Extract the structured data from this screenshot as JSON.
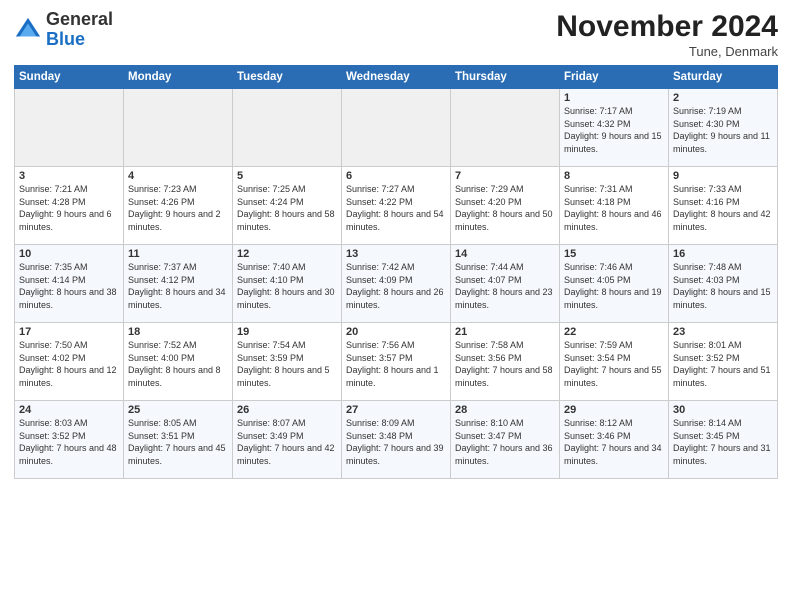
{
  "logo": {
    "general": "General",
    "blue": "Blue"
  },
  "header": {
    "title": "November 2024",
    "location": "Tune, Denmark"
  },
  "days_of_week": [
    "Sunday",
    "Monday",
    "Tuesday",
    "Wednesday",
    "Thursday",
    "Friday",
    "Saturday"
  ],
  "weeks": [
    [
      {
        "day": "",
        "sunrise": "",
        "sunset": "",
        "daylight": "",
        "empty": true
      },
      {
        "day": "",
        "sunrise": "",
        "sunset": "",
        "daylight": "",
        "empty": true
      },
      {
        "day": "",
        "sunrise": "",
        "sunset": "",
        "daylight": "",
        "empty": true
      },
      {
        "day": "",
        "sunrise": "",
        "sunset": "",
        "daylight": "",
        "empty": true
      },
      {
        "day": "",
        "sunrise": "",
        "sunset": "",
        "daylight": "",
        "empty": true
      },
      {
        "day": "1",
        "sunrise": "Sunrise: 7:17 AM",
        "sunset": "Sunset: 4:32 PM",
        "daylight": "Daylight: 9 hours and 15 minutes.",
        "empty": false
      },
      {
        "day": "2",
        "sunrise": "Sunrise: 7:19 AM",
        "sunset": "Sunset: 4:30 PM",
        "daylight": "Daylight: 9 hours and 11 minutes.",
        "empty": false
      }
    ],
    [
      {
        "day": "3",
        "sunrise": "Sunrise: 7:21 AM",
        "sunset": "Sunset: 4:28 PM",
        "daylight": "Daylight: 9 hours and 6 minutes.",
        "empty": false
      },
      {
        "day": "4",
        "sunrise": "Sunrise: 7:23 AM",
        "sunset": "Sunset: 4:26 PM",
        "daylight": "Daylight: 9 hours and 2 minutes.",
        "empty": false
      },
      {
        "day": "5",
        "sunrise": "Sunrise: 7:25 AM",
        "sunset": "Sunset: 4:24 PM",
        "daylight": "Daylight: 8 hours and 58 minutes.",
        "empty": false
      },
      {
        "day": "6",
        "sunrise": "Sunrise: 7:27 AM",
        "sunset": "Sunset: 4:22 PM",
        "daylight": "Daylight: 8 hours and 54 minutes.",
        "empty": false
      },
      {
        "day": "7",
        "sunrise": "Sunrise: 7:29 AM",
        "sunset": "Sunset: 4:20 PM",
        "daylight": "Daylight: 8 hours and 50 minutes.",
        "empty": false
      },
      {
        "day": "8",
        "sunrise": "Sunrise: 7:31 AM",
        "sunset": "Sunset: 4:18 PM",
        "daylight": "Daylight: 8 hours and 46 minutes.",
        "empty": false
      },
      {
        "day": "9",
        "sunrise": "Sunrise: 7:33 AM",
        "sunset": "Sunset: 4:16 PM",
        "daylight": "Daylight: 8 hours and 42 minutes.",
        "empty": false
      }
    ],
    [
      {
        "day": "10",
        "sunrise": "Sunrise: 7:35 AM",
        "sunset": "Sunset: 4:14 PM",
        "daylight": "Daylight: 8 hours and 38 minutes.",
        "empty": false
      },
      {
        "day": "11",
        "sunrise": "Sunrise: 7:37 AM",
        "sunset": "Sunset: 4:12 PM",
        "daylight": "Daylight: 8 hours and 34 minutes.",
        "empty": false
      },
      {
        "day": "12",
        "sunrise": "Sunrise: 7:40 AM",
        "sunset": "Sunset: 4:10 PM",
        "daylight": "Daylight: 8 hours and 30 minutes.",
        "empty": false
      },
      {
        "day": "13",
        "sunrise": "Sunrise: 7:42 AM",
        "sunset": "Sunset: 4:09 PM",
        "daylight": "Daylight: 8 hours and 26 minutes.",
        "empty": false
      },
      {
        "day": "14",
        "sunrise": "Sunrise: 7:44 AM",
        "sunset": "Sunset: 4:07 PM",
        "daylight": "Daylight: 8 hours and 23 minutes.",
        "empty": false
      },
      {
        "day": "15",
        "sunrise": "Sunrise: 7:46 AM",
        "sunset": "Sunset: 4:05 PM",
        "daylight": "Daylight: 8 hours and 19 minutes.",
        "empty": false
      },
      {
        "day": "16",
        "sunrise": "Sunrise: 7:48 AM",
        "sunset": "Sunset: 4:03 PM",
        "daylight": "Daylight: 8 hours and 15 minutes.",
        "empty": false
      }
    ],
    [
      {
        "day": "17",
        "sunrise": "Sunrise: 7:50 AM",
        "sunset": "Sunset: 4:02 PM",
        "daylight": "Daylight: 8 hours and 12 minutes.",
        "empty": false
      },
      {
        "day": "18",
        "sunrise": "Sunrise: 7:52 AM",
        "sunset": "Sunset: 4:00 PM",
        "daylight": "Daylight: 8 hours and 8 minutes.",
        "empty": false
      },
      {
        "day": "19",
        "sunrise": "Sunrise: 7:54 AM",
        "sunset": "Sunset: 3:59 PM",
        "daylight": "Daylight: 8 hours and 5 minutes.",
        "empty": false
      },
      {
        "day": "20",
        "sunrise": "Sunrise: 7:56 AM",
        "sunset": "Sunset: 3:57 PM",
        "daylight": "Daylight: 8 hours and 1 minute.",
        "empty": false
      },
      {
        "day": "21",
        "sunrise": "Sunrise: 7:58 AM",
        "sunset": "Sunset: 3:56 PM",
        "daylight": "Daylight: 7 hours and 58 minutes.",
        "empty": false
      },
      {
        "day": "22",
        "sunrise": "Sunrise: 7:59 AM",
        "sunset": "Sunset: 3:54 PM",
        "daylight": "Daylight: 7 hours and 55 minutes.",
        "empty": false
      },
      {
        "day": "23",
        "sunrise": "Sunrise: 8:01 AM",
        "sunset": "Sunset: 3:52 PM",
        "daylight": "Daylight: 7 hours and 51 minutes.",
        "empty": false
      }
    ],
    [
      {
        "day": "24",
        "sunrise": "Sunrise: 8:03 AM",
        "sunset": "Sunset: 3:52 PM",
        "daylight": "Daylight: 7 hours and 48 minutes.",
        "empty": false
      },
      {
        "day": "25",
        "sunrise": "Sunrise: 8:05 AM",
        "sunset": "Sunset: 3:51 PM",
        "daylight": "Daylight: 7 hours and 45 minutes.",
        "empty": false
      },
      {
        "day": "26",
        "sunrise": "Sunrise: 8:07 AM",
        "sunset": "Sunset: 3:49 PM",
        "daylight": "Daylight: 7 hours and 42 minutes.",
        "empty": false
      },
      {
        "day": "27",
        "sunrise": "Sunrise: 8:09 AM",
        "sunset": "Sunset: 3:48 PM",
        "daylight": "Daylight: 7 hours and 39 minutes.",
        "empty": false
      },
      {
        "day": "28",
        "sunrise": "Sunrise: 8:10 AM",
        "sunset": "Sunset: 3:47 PM",
        "daylight": "Daylight: 7 hours and 36 minutes.",
        "empty": false
      },
      {
        "day": "29",
        "sunrise": "Sunrise: 8:12 AM",
        "sunset": "Sunset: 3:46 PM",
        "daylight": "Daylight: 7 hours and 34 minutes.",
        "empty": false
      },
      {
        "day": "30",
        "sunrise": "Sunrise: 8:14 AM",
        "sunset": "Sunset: 3:45 PM",
        "daylight": "Daylight: 7 hours and 31 minutes.",
        "empty": false
      }
    ]
  ]
}
